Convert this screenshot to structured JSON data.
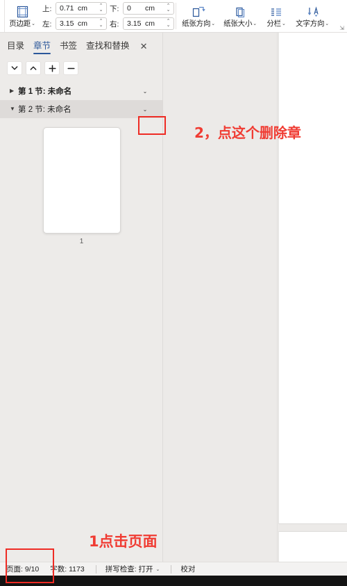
{
  "ribbon": {
    "margins_button": {
      "label": "页边距",
      "icon": "page-margins-icon",
      "caret": "⌄"
    },
    "fields": [
      {
        "name": "top",
        "label": "上:",
        "value": "0.71",
        "unit": "cm"
      },
      {
        "name": "bottom",
        "label": "下:",
        "value": "0",
        "unit": "cm"
      },
      {
        "name": "left",
        "label": "左:",
        "value": "3.15",
        "unit": "cm"
      },
      {
        "name": "right",
        "label": "右:",
        "value": "3.15",
        "unit": "cm"
      }
    ],
    "buttons": [
      {
        "label": "纸张方向",
        "icon": "page-orientation-icon",
        "caret": "⌄"
      },
      {
        "label": "纸张大小",
        "icon": "page-size-icon",
        "caret": "⌄"
      },
      {
        "label": "分栏",
        "icon": "columns-icon",
        "caret": "⌄"
      },
      {
        "label": "文字方向",
        "icon": "text-direction-icon",
        "caret": "⌄"
      }
    ],
    "dialog_launcher": "⇲"
  },
  "sidebar": {
    "tabs": [
      {
        "label": "目录",
        "active": false
      },
      {
        "label": "章节",
        "active": true
      },
      {
        "label": "书签",
        "active": false
      },
      {
        "label": "查找和替换",
        "active": false
      }
    ],
    "close_label": "✕",
    "toolbar_buttons": [
      {
        "name": "move-down-button",
        "icon": "chevron-down-icon"
      },
      {
        "name": "move-up-button",
        "icon": "chevron-up-icon"
      },
      {
        "name": "add-section-button",
        "icon": "plus-icon"
      },
      {
        "name": "remove-section-button",
        "icon": "minus-icon"
      }
    ],
    "sections": [
      {
        "label": "第 1 节: 未命名",
        "expanded": false,
        "triangle": "▶",
        "caret": "⌄",
        "selected": false
      },
      {
        "label": "第 2 节: 未命名",
        "expanded": true,
        "triangle": "▼",
        "caret": "⌄",
        "selected": true
      }
    ],
    "thumbnail": {
      "page_number": "1"
    }
  },
  "statusbar": {
    "page": "页面: 9/10",
    "words": "字数: 1173",
    "spellcheck": "拼写检查: 打开",
    "spellcheck_caret": "⌄",
    "proofread": "校对"
  },
  "annotations": [
    {
      "name": "annotation-delete-section",
      "text": "2，点这个删除章"
    },
    {
      "name": "annotation-click-page",
      "text": "1点击页面"
    }
  ],
  "colors": {
    "annotation_red": "#f03c33",
    "box_red": "#ee2b24",
    "accent_blue": "#2b579a",
    "selected_row": "#dedbd9"
  }
}
